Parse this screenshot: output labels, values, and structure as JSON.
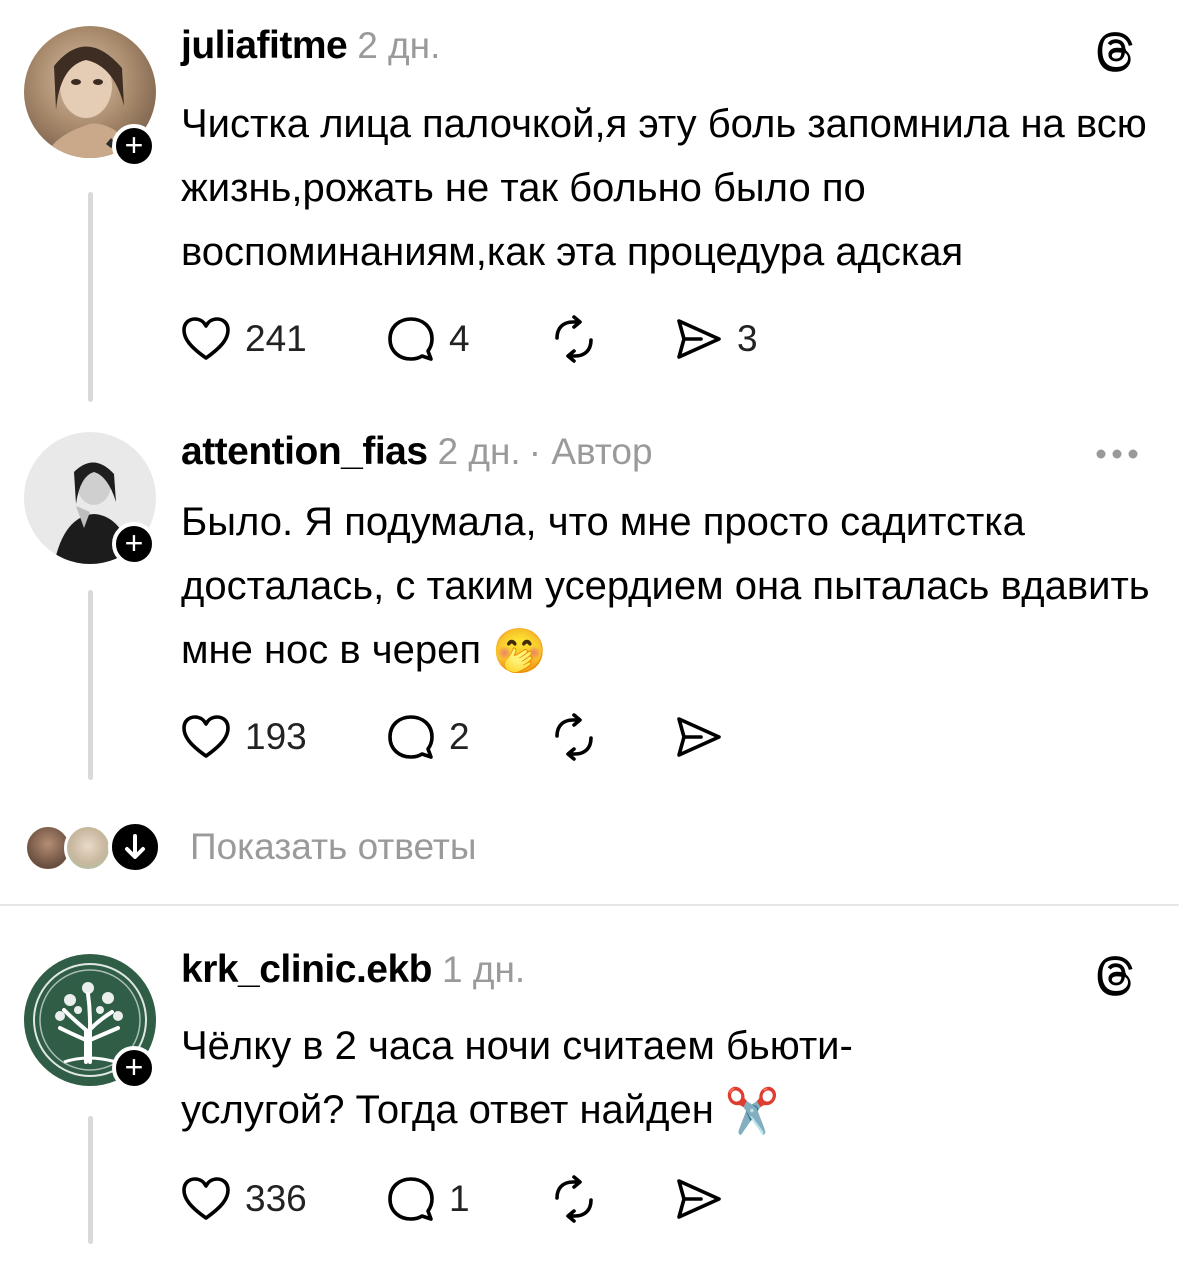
{
  "posts": [
    {
      "username": "juliafitme",
      "time": "2 дн.",
      "author_tag": "",
      "text": "Чистка лица палочкой,я эту боль запомнила на всю жизнь,рожать не так больно было по воспоминаниям,как эта процедура адская",
      "likes": "241",
      "replies": "4",
      "shares": "3",
      "avatar_icon": "user-avatar-photo",
      "corner_icon": "threads-logo-icon"
    },
    {
      "username": "attention_fias",
      "time": "2 дн.",
      "author_tag": "· Автор",
      "text": "Было. Я подумала, что мне просто садитстка досталась, с таким усердием она пыталась вдавить мне нос в череп",
      "emoji": "🤭",
      "likes": "193",
      "replies": "2",
      "shares": "",
      "avatar_icon": "user-avatar-photo-bw",
      "corner_icon": "more-dots-icon"
    },
    {
      "username": "krk_clinic.ekb",
      "time": "1 дн.",
      "author_tag": "",
      "text": "Чёлку в 2 часа ночи считаем бьюти-услугой? Тогда ответ найден",
      "emoji": "✂️",
      "likes": "336",
      "replies": "1",
      "shares": "",
      "avatar_icon": "tree-logo-avatar",
      "corner_icon": "threads-logo-icon"
    }
  ],
  "show_replies_label": "Показать ответы",
  "colors": {
    "text": "#000000",
    "muted": "#9a9a9a",
    "line": "#d9d9d9",
    "clinic_green": "#2f5d46"
  }
}
